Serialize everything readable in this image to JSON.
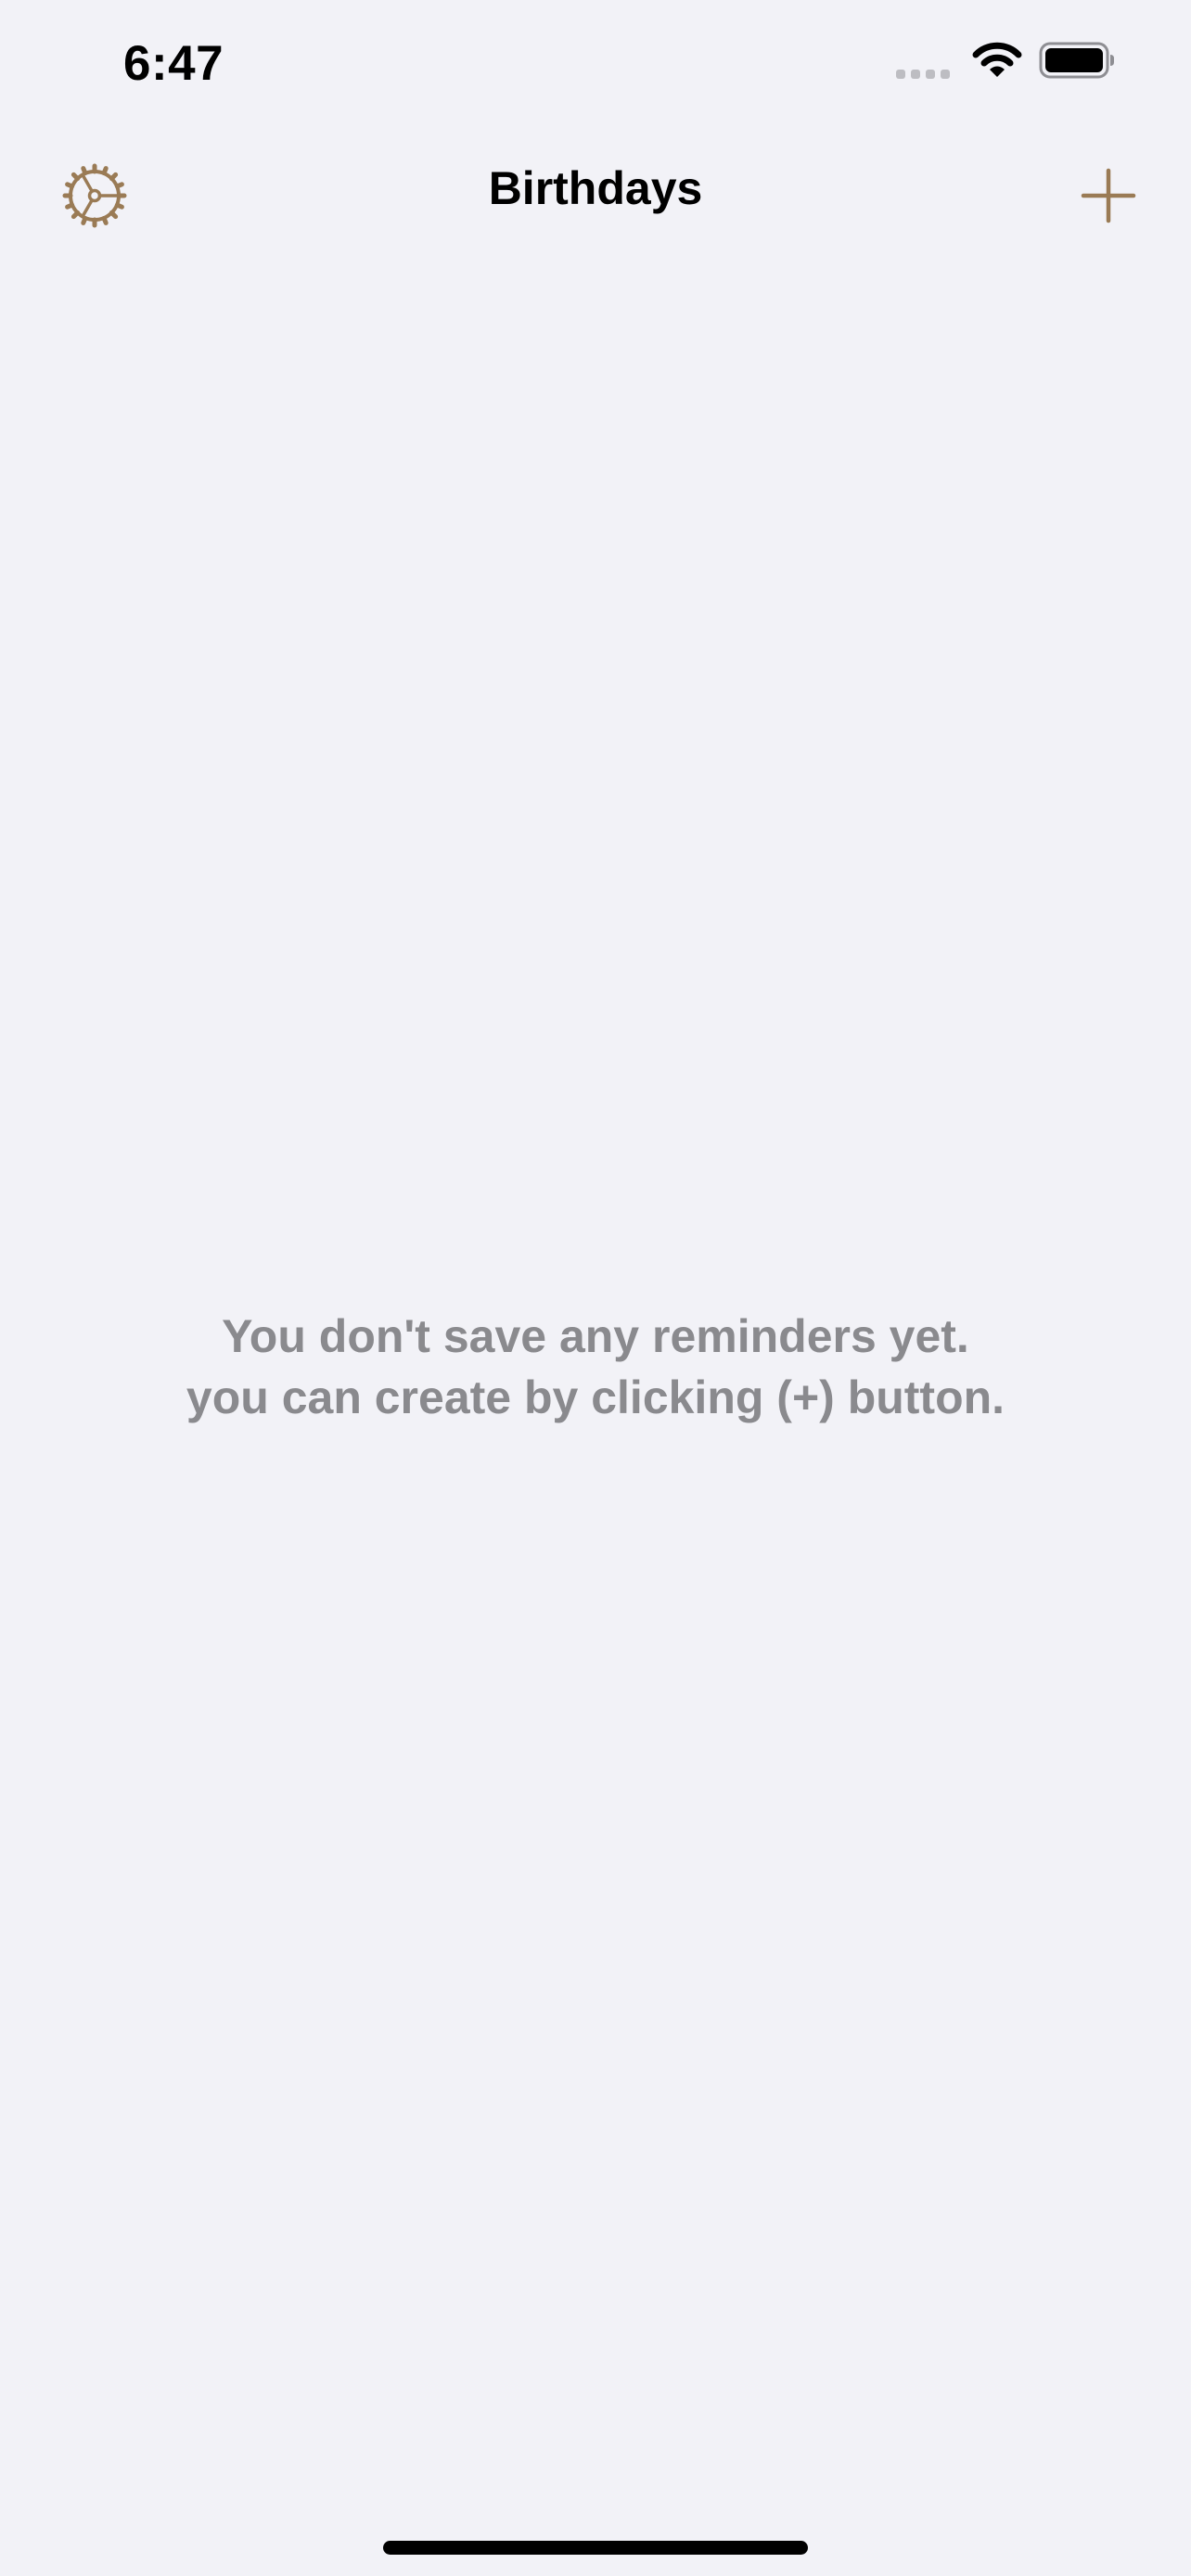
{
  "status_bar": {
    "time": "6:47",
    "icons": [
      "cellular-signal-icon",
      "wifi-icon",
      "battery-icon"
    ]
  },
  "nav": {
    "title": "Birthdays",
    "left_icon": "gear-icon",
    "right_icon": "plus-icon",
    "accent_color": "#9A7B55"
  },
  "empty_state": {
    "line1": "You don't save any reminders yet.",
    "line2": "you can create by clicking (+) button."
  },
  "colors": {
    "background": "#F2F2F7",
    "empty_text": "#8A8A8E"
  }
}
